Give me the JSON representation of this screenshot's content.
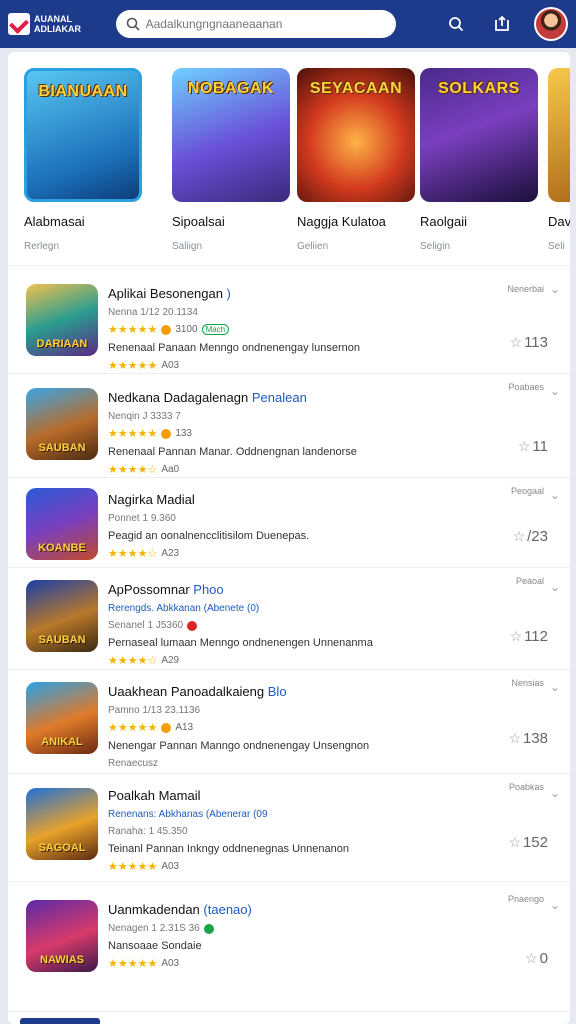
{
  "header": {
    "logo_line1": "AUANAL",
    "logo_line2": "ADLIAKAR",
    "search_placeholder": "Aadalkungngnaaneaanan",
    "icons": [
      "search-icon",
      "upload-icon"
    ]
  },
  "featured": [
    {
      "title": "BIANUAAN",
      "name": "Alabmasai",
      "category": "Rerlegn"
    },
    {
      "title": "NOBAGAK",
      "name": "Sipoalsai",
      "category": "Saliign"
    },
    {
      "title": "SEYACAAN",
      "name": "Naggja Kulatoa",
      "category": "Geliien"
    },
    {
      "title": "SOLKARS",
      "name": "Raolgaii",
      "category": "Seligin"
    },
    {
      "title": "",
      "name": "Dav",
      "category": "Seli"
    }
  ],
  "apps": [
    {
      "icon_text": "DARIAAN",
      "title": "Aplikai Besonengan",
      "tag": ")",
      "sub": "Nenna 1/12 20.1134",
      "sub_extra": "3100",
      "pill": "Mach",
      "desc": "Renenaal Panaan Menngo ondnenengay lunsernon",
      "count": "A03",
      "meta": "Nenerbai",
      "rating": "113"
    },
    {
      "icon_text": "SAUBAN",
      "title": "Nedkana Dadagalenagn",
      "tag": "Penalean",
      "sub": "Nenqin J 3333 7",
      "sub_extra": "133",
      "desc": "Renenaal Pannan Manar. Oddnengnan landenorse",
      "count": "Aa0",
      "meta": "Poabaes",
      "rating": "11"
    },
    {
      "icon_text": "KOANBE",
      "title": "Nagirka Madial",
      "tag": "",
      "sub": "Ponnet 1 9.360",
      "desc": "Peagid an oonalnencclitisilom Duenepas.",
      "count": "A23",
      "meta": "Peogaal",
      "rating": "/23"
    },
    {
      "icon_text": "SAUBAN",
      "title": "ApPossomnar",
      "tag": "Phoo",
      "sub": "Rerengds. Abkkanan (Abenete (0)",
      "sub2": "Senanel 1 J5360",
      "desc": "Pernaseal lumaan Menngo ondnenengen Unnenanma",
      "count": "A29",
      "meta": "Peaoal",
      "rating": "112"
    },
    {
      "icon_text": "ANIKAL",
      "title": "Uaakhean Panoadalkaieng",
      "tag": "Blo",
      "sub": "Pamno 1/13 23.1136",
      "sub_extra": "A13",
      "desc": "Nenengar Pannan Manngo ondnenengay Unsengnon",
      "count": "Renaecusz",
      "meta": "Nensias",
      "rating": "138"
    },
    {
      "icon_text": "SAGOAL",
      "title": "Poalkah Mamail",
      "tag": "",
      "sub": "Renenans: Abkhanas (Abenerar (09",
      "sub2": "Ranaha: 1 45.350",
      "desc": "Teinanl Pannan Inkngy oddnenegnas Unnenanon",
      "count": "A03",
      "meta": "Poabkas",
      "rating": "152"
    },
    {
      "icon_text": "NAWIAS",
      "title": "Uanmkadendan",
      "tag": "(taenao)",
      "sub": "Nenagen 1 2.31S 36",
      "desc": "Nansoaae Sondaie",
      "count": "A03",
      "meta": "Pnaengo",
      "rating": "0"
    }
  ]
}
